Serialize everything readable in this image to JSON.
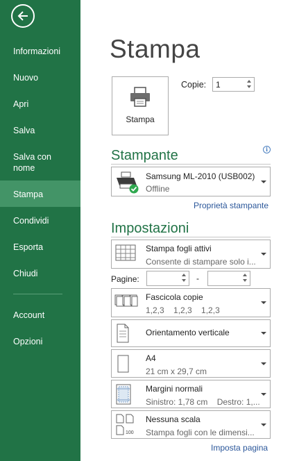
{
  "sidebar": {
    "items": [
      {
        "label": "Informazioni"
      },
      {
        "label": "Nuovo"
      },
      {
        "label": "Apri"
      },
      {
        "label": "Salva"
      },
      {
        "label": "Salva con nome"
      },
      {
        "label": "Stampa"
      },
      {
        "label": "Condividi"
      },
      {
        "label": "Esporta"
      },
      {
        "label": "Chiudi"
      },
      {
        "label": "Account"
      },
      {
        "label": "Opzioni"
      }
    ],
    "active": "Stampa"
  },
  "main": {
    "title": "Stampa",
    "print_button": "Stampa",
    "copies_label": "Copie:",
    "copies_value": "1",
    "printer_heading": "Stampante",
    "printer": {
      "name": "Samsung ML-2010 (USB002)",
      "status": "Offline"
    },
    "printer_properties_link": "Proprietà stampante",
    "settings_heading": "Impostazioni",
    "settings": [
      {
        "title": "Stampa fogli attivi",
        "subtitle": "Consente di stampare solo i..."
      },
      {
        "title": "Fascicola copie",
        "subtitle": "1,2,3    1,2,3    1,2,3"
      },
      {
        "title": "Orientamento verticale",
        "subtitle": ""
      },
      {
        "title": "A4",
        "subtitle": "21 cm x 29,7 cm"
      },
      {
        "title": "Margini normali",
        "subtitle": "Sinistro: 1,78 cm    Destro: 1,..."
      },
      {
        "title": "Nessuna scala",
        "subtitle": "Stampa fogli con le dimensi..."
      }
    ],
    "pages_label": "Pagine:",
    "pages_from": "",
    "pages_to": "",
    "pages_dash": "-",
    "page_setup_link": "Imposta pagina"
  },
  "colors": {
    "accent": "#217346",
    "active_item": "#439467",
    "link": "#2b579a"
  },
  "icons": [
    "back-arrow-icon",
    "printer-icon",
    "info-icon",
    "printer-status-icon",
    "sheets-icon",
    "collate-icon",
    "portrait-icon",
    "paper-size-icon",
    "margins-icon",
    "scaling-icon"
  ]
}
